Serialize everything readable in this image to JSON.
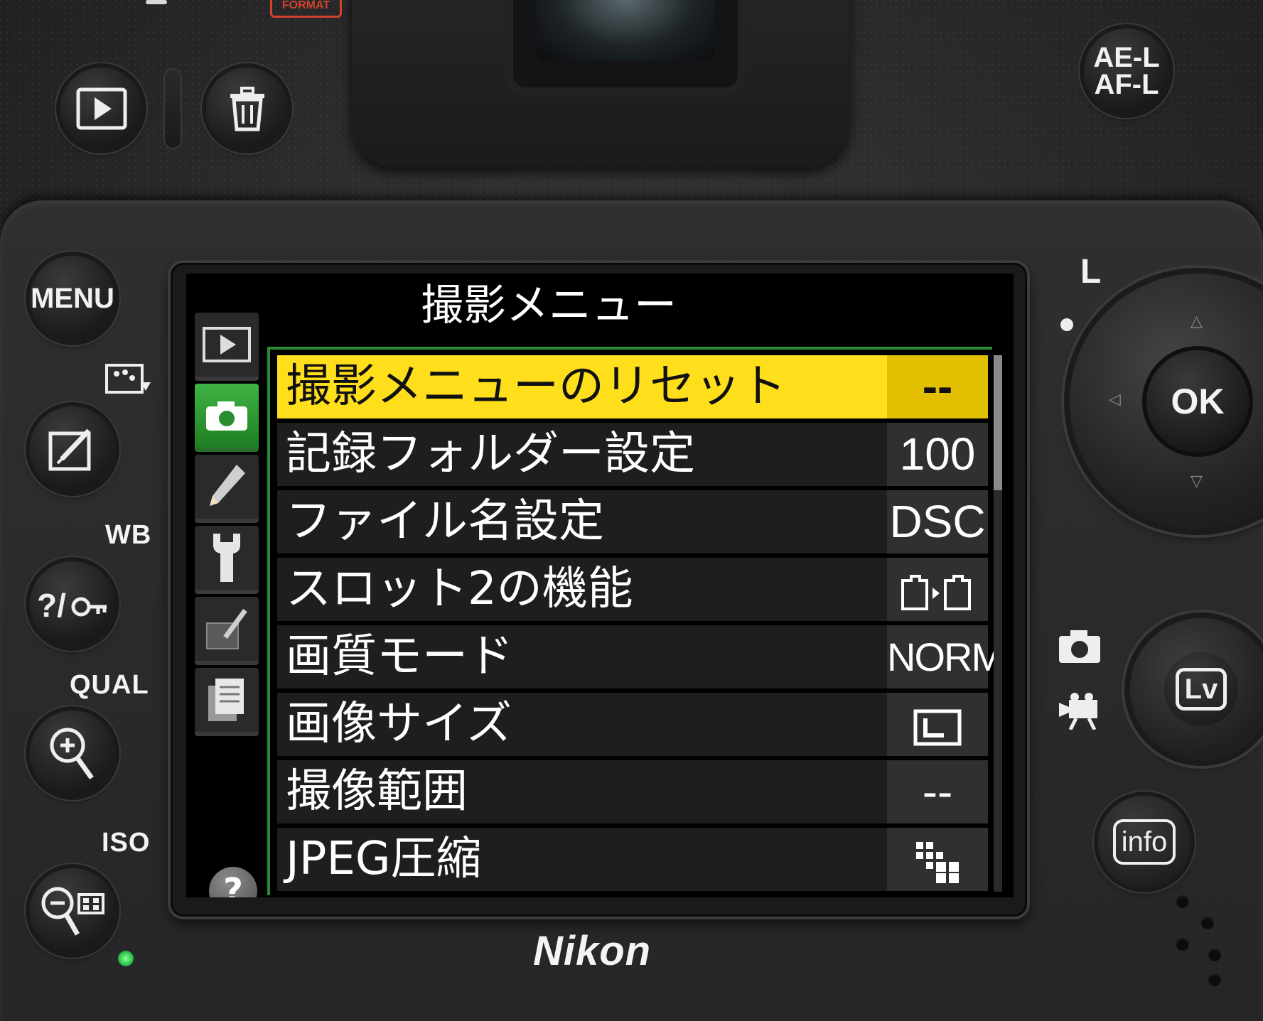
{
  "camera": {
    "brand": "Nikon",
    "format_mark": "FORMAT",
    "buttons": {
      "ael_afl": "AE-L\nAF-L",
      "menu": "MENU",
      "ok": "OK",
      "lv": "Lv",
      "info": "info"
    },
    "labels": {
      "wb": "WB",
      "qual": "QUAL",
      "iso": "ISO",
      "lock_l": "L"
    }
  },
  "screen": {
    "title": "撮影メニュー",
    "tabs": [
      {
        "name": "playback-menu",
        "icon": "play-icon"
      },
      {
        "name": "shooting-menu",
        "icon": "camera-icon",
        "active": true
      },
      {
        "name": "custom-settings",
        "icon": "pencil-icon"
      },
      {
        "name": "setup-menu",
        "icon": "wrench-icon"
      },
      {
        "name": "retouch-menu",
        "icon": "retouch-brush-icon"
      },
      {
        "name": "recent-settings",
        "icon": "document-stack-icon"
      }
    ],
    "help": "?",
    "items": [
      {
        "label": "撮影メニューのリセット",
        "value": "--",
        "selected": true
      },
      {
        "label": "記録フォルダー設定",
        "value": "100"
      },
      {
        "label": "ファイル名設定",
        "value": "DSC"
      },
      {
        "label": "スロット2の機能",
        "value": "",
        "icon": "card-overflow-icon"
      },
      {
        "label": "画質モード",
        "value": "NORM"
      },
      {
        "label": "画像サイズ",
        "value": "",
        "icon": "image-size-large-icon"
      },
      {
        "label": "撮像範囲",
        "value": "--"
      },
      {
        "label": "JPEG圧縮",
        "value": "",
        "icon": "compression-icon"
      }
    ],
    "scroll_position": 0.0,
    "colors": {
      "highlight": "#ffde1c",
      "active_tab": "#3fb344"
    }
  }
}
